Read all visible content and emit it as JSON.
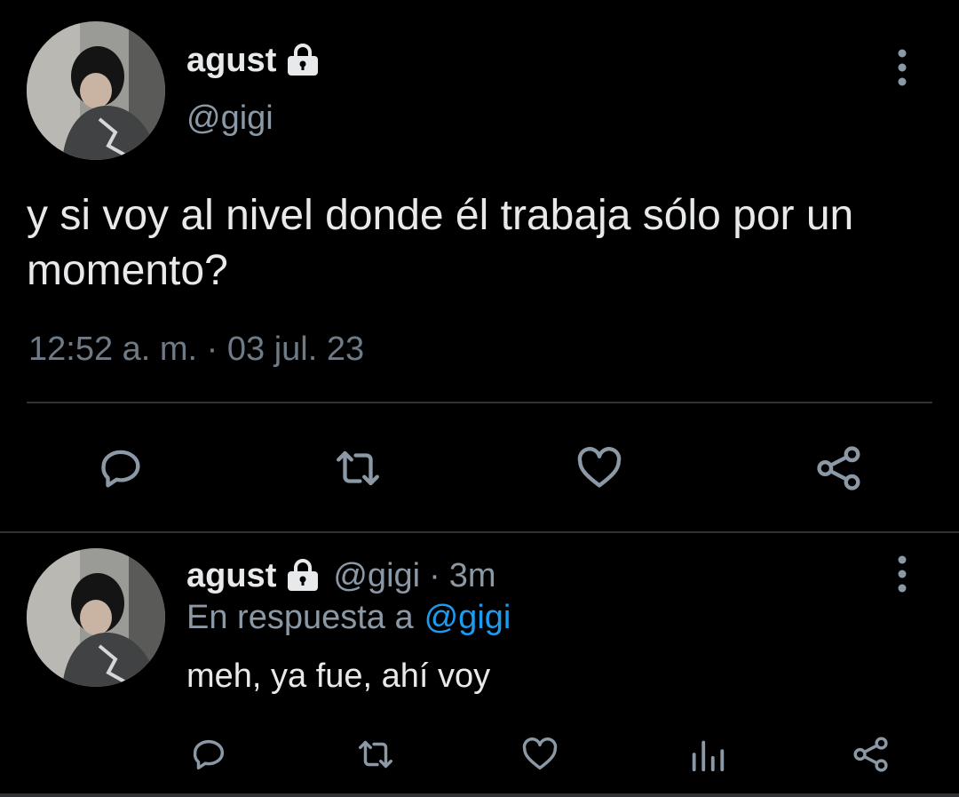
{
  "main_tweet": {
    "display_name": "agust",
    "handle": "@gigi",
    "text": "y si voy al nivel donde él trabaja sólo por un momento?",
    "timestamp": "12:52 a. m. · 03 jul. 23",
    "icons": {
      "lock": "lock-icon",
      "more": "more-vertical-icon",
      "reply": "reply-icon",
      "retweet": "retweet-icon",
      "like": "heart-icon",
      "share": "share-icon"
    }
  },
  "reply_tweet": {
    "display_name": "agust",
    "handle": "@gigi",
    "separator": "·",
    "time_ago": "3m",
    "reply_to_label": "En respuesta a",
    "reply_to_handle": "@gigi",
    "text": "meh, ya fue, ahí voy",
    "icons": {
      "lock": "lock-icon",
      "more": "more-vertical-icon",
      "reply": "reply-icon",
      "retweet": "retweet-icon",
      "like": "heart-icon",
      "analytics": "analytics-icon",
      "share": "share-icon"
    }
  },
  "colors": {
    "background": "#000000",
    "primary_text": "#e7e9ea",
    "secondary_text": "#8b98a5",
    "timestamp_text": "#6e7b87",
    "icon": "#8b98a5",
    "link": "#1d9bf0",
    "divider": "#2f3336"
  }
}
